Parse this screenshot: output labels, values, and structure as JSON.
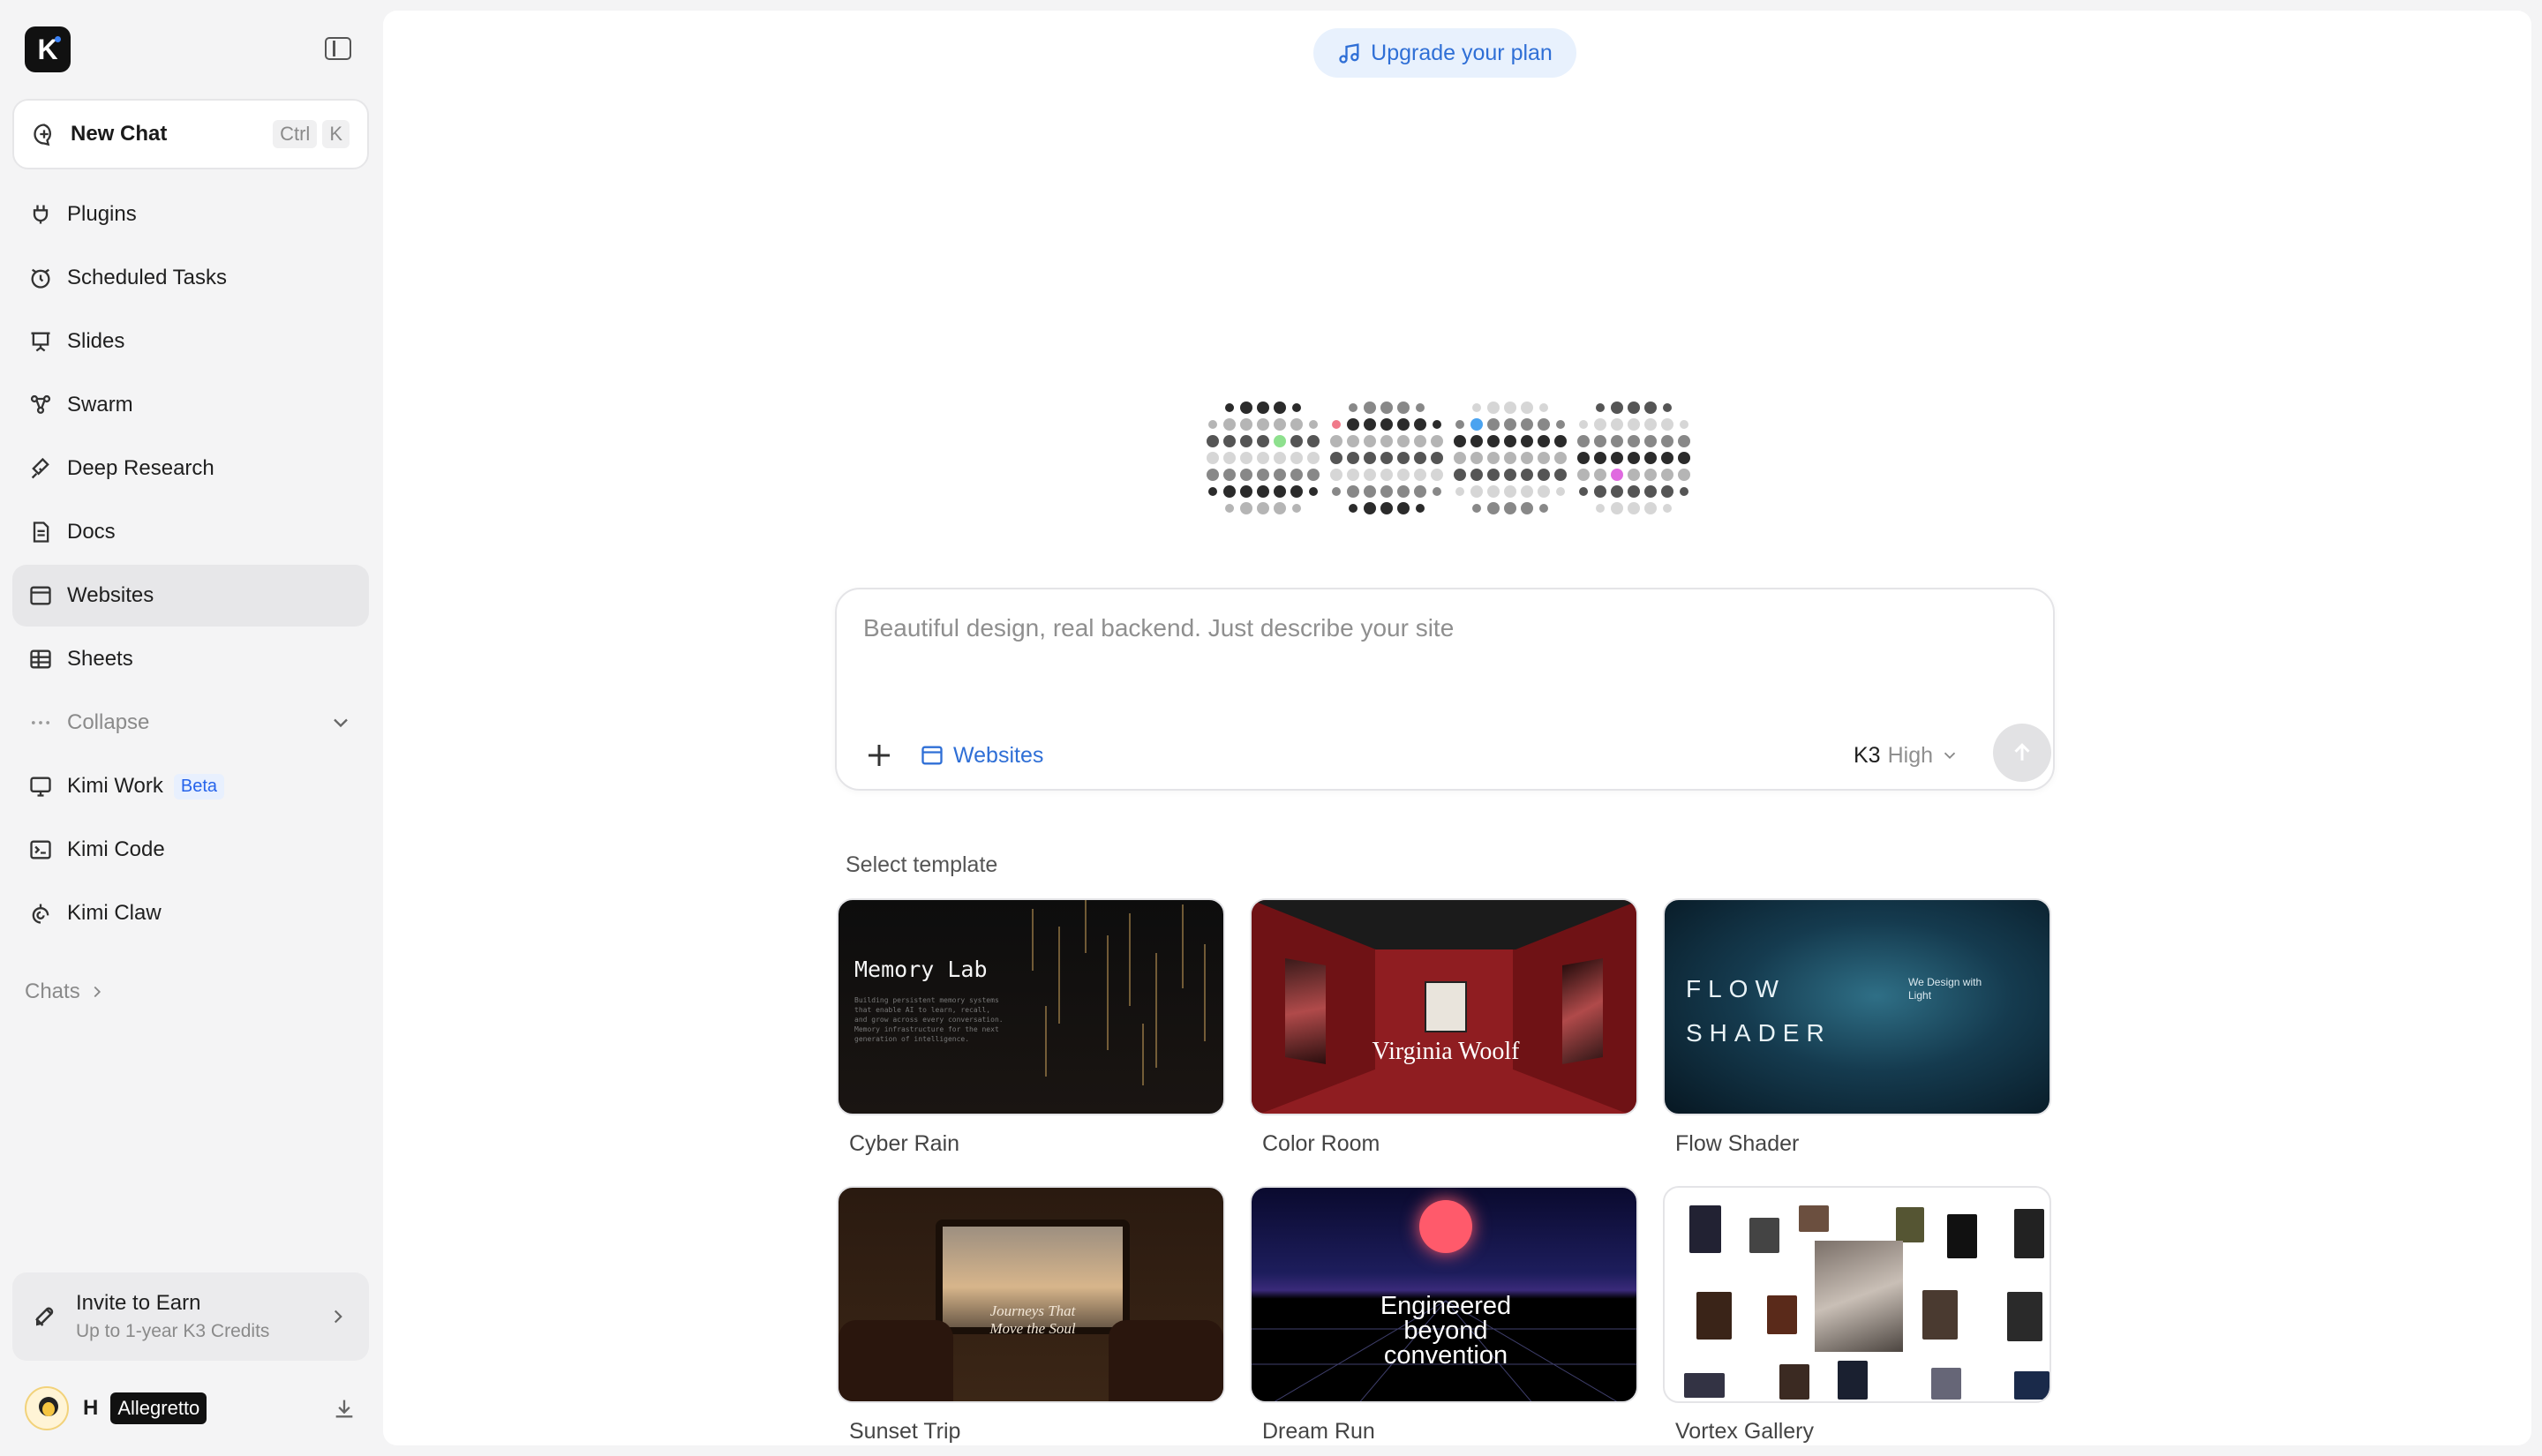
{
  "sidebar": {
    "logo": "K",
    "new_chat": {
      "label": "New Chat",
      "kbd1": "Ctrl",
      "kbd2": "K"
    },
    "items": [
      {
        "label": "Plugins",
        "icon": "plugin-icon"
      },
      {
        "label": "Scheduled Tasks",
        "icon": "alarm-icon"
      },
      {
        "label": "Slides",
        "icon": "presentation-icon"
      },
      {
        "label": "Swarm",
        "icon": "swarm-icon"
      },
      {
        "label": "Deep Research",
        "icon": "research-icon"
      },
      {
        "label": "Docs",
        "icon": "document-icon"
      },
      {
        "label": "Websites",
        "icon": "browser-icon",
        "active": true
      },
      {
        "label": "Sheets",
        "icon": "table-icon"
      },
      {
        "label": "Collapse",
        "icon": "ellipsis-icon"
      },
      {
        "label": "Kimi Work",
        "icon": "monitor-icon",
        "badge": "Beta"
      },
      {
        "label": "Kimi Code",
        "icon": "terminal-icon"
      },
      {
        "label": "Kimi Claw",
        "icon": "claw-icon"
      }
    ],
    "chats_label": "Chats",
    "invite": {
      "title": "Invite to Earn",
      "subtitle": "Up to 1-year K3 Credits"
    },
    "user": {
      "initial": "H",
      "plan": "Allegretto"
    }
  },
  "main": {
    "upgrade_label": "Upgrade your plan",
    "input": {
      "placeholder": "Beautiful design, real backend. Just describe your site",
      "value": "",
      "mode_label": "Websites",
      "model": "K3",
      "level": "High"
    },
    "templates_heading": "Select template",
    "templates": [
      {
        "name": "Cyber Rain",
        "thumb_title": "Memory Lab",
        "thumb_body": "Building persistent memory systems that enable AI to learn, recall, and grow across every conversation. Memory infrastructure for the next generation of intelligence."
      },
      {
        "name": "Color Room",
        "thumb_title": "Virginia Woolf"
      },
      {
        "name": "Flow Shader",
        "thumb_title_1": "FLOW",
        "thumb_title_2": "SHADER",
        "thumb_side": "We Design with Light"
      },
      {
        "name": "Sunset Trip",
        "thumb_title_1": "Journeys That",
        "thumb_title_2": "Move the Soul"
      },
      {
        "name": "Dream Run",
        "thumb_title_1": "Engineered",
        "thumb_title_2": "beyond",
        "thumb_title_3": "convention"
      },
      {
        "name": "Vortex Gallery"
      }
    ]
  },
  "colors": {
    "accent": "#2f6fd6",
    "active_bg": "#e7e7e9",
    "sidebar_bg": "#f4f4f5"
  }
}
